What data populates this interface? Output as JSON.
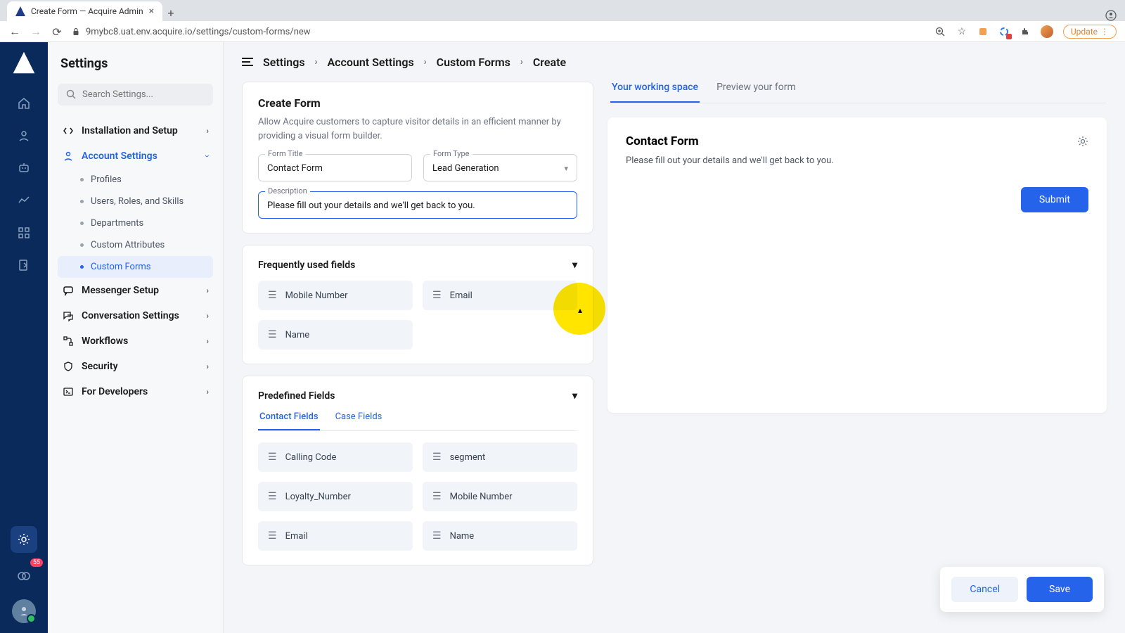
{
  "browser": {
    "tab_title": "Create Form — Acquire Admin",
    "url": "9mybc8.uat.env.acquire.io/settings/custom-forms/new",
    "update_label": "Update"
  },
  "sidebar": {
    "title": "Settings",
    "search_placeholder": "Search Settings...",
    "groups": [
      {
        "label": "Installation and Setup"
      },
      {
        "label": "Account Settings",
        "subs": [
          "Profiles",
          "Users, Roles, and Skills",
          "Departments",
          "Custom Attributes",
          "Custom Forms"
        ]
      },
      {
        "label": "Messenger Setup"
      },
      {
        "label": "Conversation Settings"
      },
      {
        "label": "Workflows"
      },
      {
        "label": "Security"
      },
      {
        "label": "For Developers"
      }
    ]
  },
  "rail": {
    "badge": "55"
  },
  "breadcrumb": [
    "Settings",
    "Account Settings",
    "Custom Forms",
    "Create"
  ],
  "form": {
    "title": "Create Form",
    "subtitle": "Allow Acquire customers to capture visitor details in an efficient manner by providing a visual form builder.",
    "form_title_label": "Form Title",
    "form_title_value": "Contact Form",
    "form_type_label": "Form Type",
    "form_type_value": "Lead Generation",
    "description_label": "Description",
    "description_value": "Please fill out your details and we'll get back to you.",
    "freq_title": "Frequently used fields",
    "freq_fields": [
      "Mobile Number",
      "Email",
      "Name"
    ],
    "predef_title": "Predefined Fields",
    "predef_tabs": [
      "Contact Fields",
      "Case Fields"
    ],
    "predef_fields": [
      "Calling Code",
      "segment",
      "Loyalty_Number",
      "Mobile Number",
      "Email",
      "Name"
    ]
  },
  "preview": {
    "tabs": [
      "Your working space",
      "Preview your form"
    ],
    "heading": "Contact Form",
    "desc": "Please fill out your details and we'll get back to you.",
    "submit": "Submit"
  },
  "actions": {
    "cancel": "Cancel",
    "save": "Save"
  }
}
